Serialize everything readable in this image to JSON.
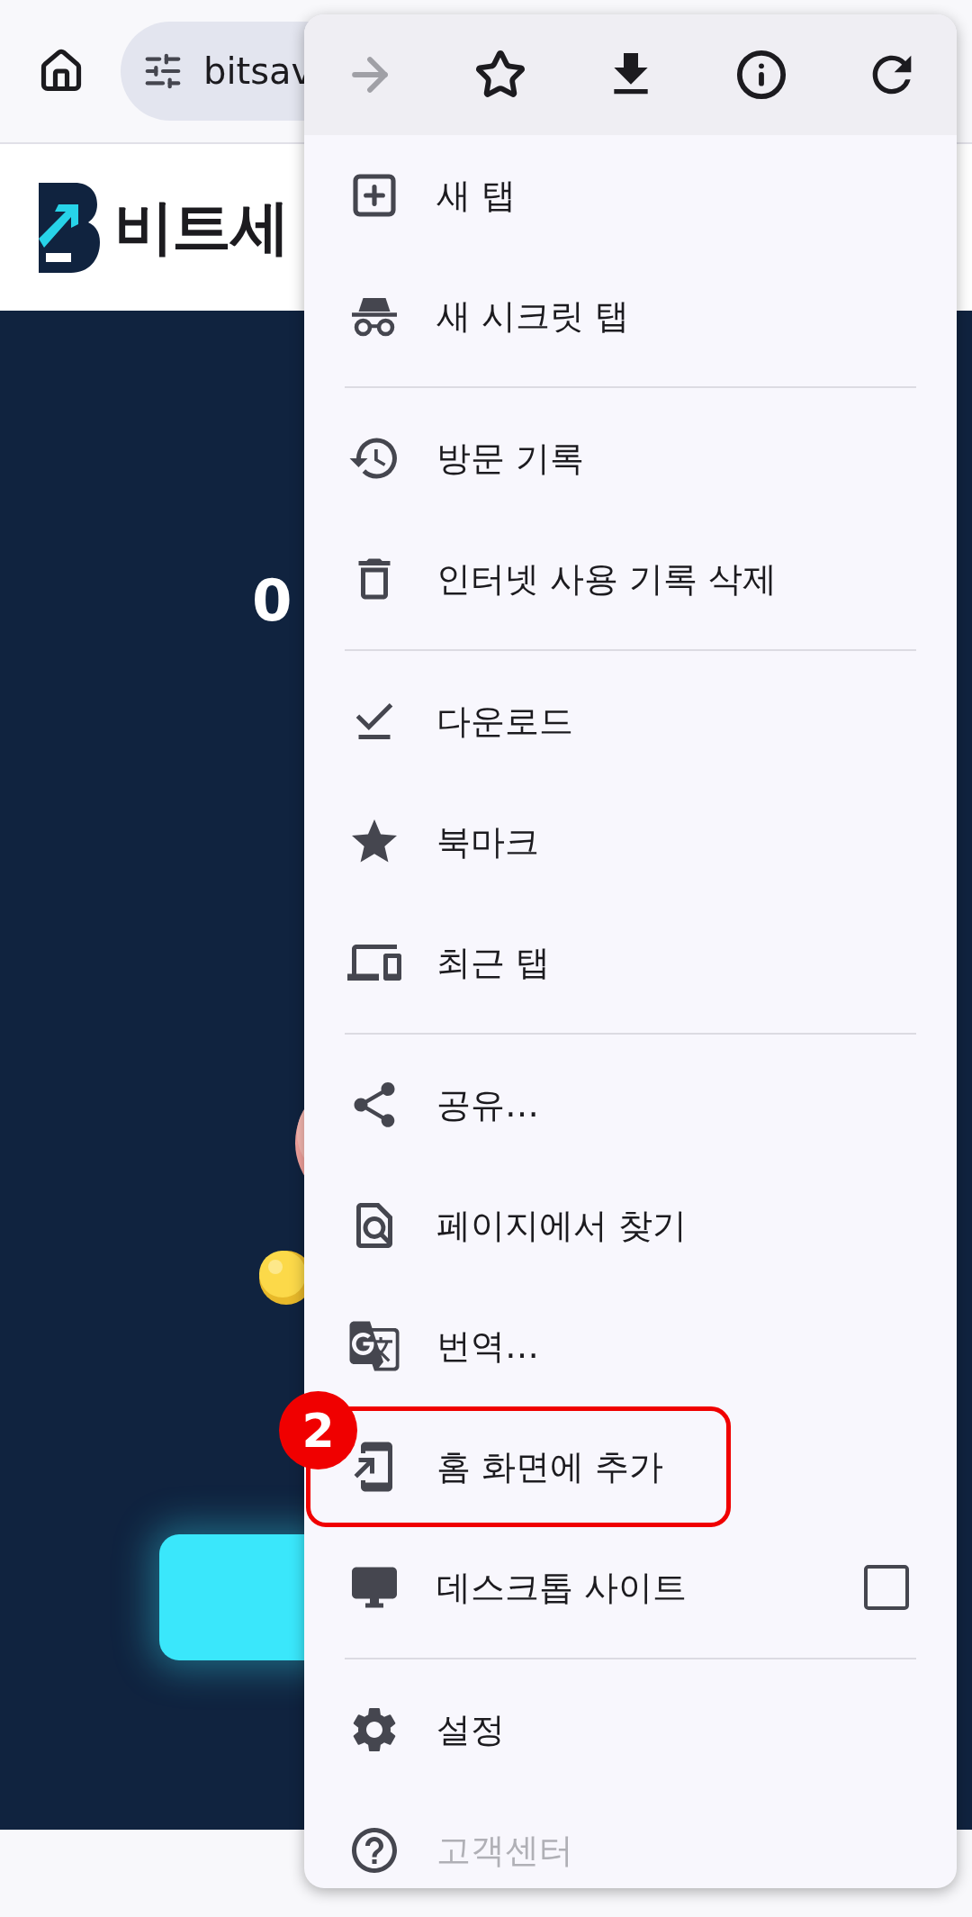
{
  "address_bar": {
    "url": "bitsav"
  },
  "site": {
    "logo_text": "비트세",
    "heading": "0"
  },
  "menu": {
    "toolbar": [
      {
        "kind": "forward",
        "disabled": true
      },
      {
        "kind": "bookmark",
        "disabled": false
      },
      {
        "kind": "download",
        "disabled": false
      },
      {
        "kind": "info",
        "disabled": false
      },
      {
        "kind": "reload",
        "disabled": false
      }
    ],
    "items": [
      {
        "kind": "item",
        "label": "새 탭",
        "highlighted": false
      },
      {
        "kind": "item",
        "label": "새 시크릿 탭",
        "highlighted": false
      },
      {
        "kind": "divider"
      },
      {
        "kind": "item",
        "label": "방문 기록",
        "highlighted": false
      },
      {
        "kind": "item",
        "label": "인터넷 사용 기록 삭제",
        "highlighted": false
      },
      {
        "kind": "divider"
      },
      {
        "kind": "item",
        "label": "다운로드",
        "highlighted": false
      },
      {
        "kind": "item",
        "label": "북마크",
        "highlighted": false
      },
      {
        "kind": "item",
        "label": "최근 탭",
        "highlighted": false
      },
      {
        "kind": "divider"
      },
      {
        "kind": "item",
        "label": "공유…",
        "highlighted": false
      },
      {
        "kind": "item",
        "label": "페이지에서 찾기",
        "highlighted": false
      },
      {
        "kind": "item",
        "label": "번역…",
        "highlighted": false
      },
      {
        "kind": "item",
        "label": "홈 화면에 추가",
        "highlighted": true,
        "badge": "2"
      },
      {
        "kind": "checkbox",
        "label": "데스크톱 사이트",
        "checked": false,
        "highlighted": false
      },
      {
        "kind": "divider"
      },
      {
        "kind": "item",
        "label": "설정",
        "highlighted": false
      },
      {
        "kind": "item",
        "label": "고객센터",
        "highlighted": false
      }
    ]
  }
}
